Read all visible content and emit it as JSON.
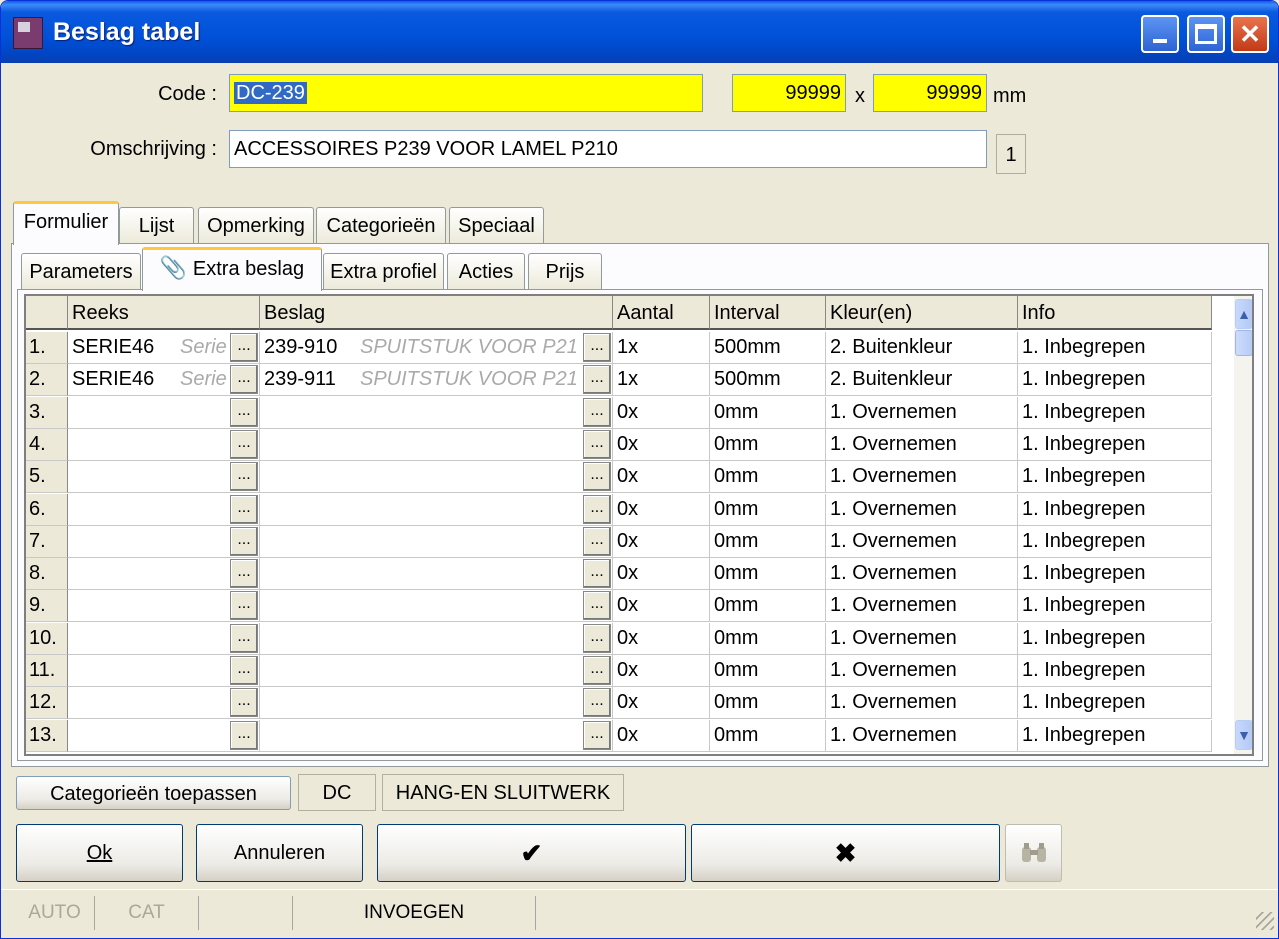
{
  "window": {
    "title": "Beslag tabel",
    "minimize_icon": "minimize-icon",
    "maximize_icon": "maximize-icon",
    "close_icon": "close-icon"
  },
  "form": {
    "code_label": "Code :",
    "code_value": "DC-239",
    "width_value": "99999",
    "times_sign": "x",
    "height_value": "99999",
    "unit": "mm",
    "omschrijving_label": "Omschrijving :",
    "omschrijving_value": "ACCESSOIRES P239 VOOR LAMEL P210",
    "counter": "1"
  },
  "main_tabs": [
    "Formulier",
    "Lijst",
    "Opmerking",
    "Categorieën",
    "Speciaal"
  ],
  "sub_tabs": [
    "Parameters",
    "Extra beslag",
    "Extra profiel",
    "Acties",
    "Prijs"
  ],
  "grid": {
    "columns": [
      "Reeks",
      "Beslag",
      "Aantal",
      "Interval",
      "Kleur(en)",
      "Info"
    ],
    "rows": [
      {
        "idx": "1.",
        "reeks": "SERIE46",
        "reeks_hint": "Serie",
        "beslag": "239-910",
        "beslag_hint": "SPUITSTUK VOOR P21",
        "aantal": "1x",
        "interval": "500mm",
        "kleur": "2. Buitenkleur",
        "info": "1. Inbegrepen"
      },
      {
        "idx": "2.",
        "reeks": "SERIE46",
        "reeks_hint": "Serie",
        "beslag": "239-911",
        "beslag_hint": "SPUITSTUK VOOR P21",
        "aantal": "1x",
        "interval": "500mm",
        "kleur": "2. Buitenkleur",
        "info": "1. Inbegrepen"
      },
      {
        "idx": "3.",
        "reeks": "",
        "reeks_hint": "",
        "beslag": "",
        "beslag_hint": "",
        "aantal": "0x",
        "interval": "0mm",
        "kleur": "1. Overnemen",
        "info": "1. Inbegrepen"
      },
      {
        "idx": "4.",
        "reeks": "",
        "reeks_hint": "",
        "beslag": "",
        "beslag_hint": "",
        "aantal": "0x",
        "interval": "0mm",
        "kleur": "1. Overnemen",
        "info": "1. Inbegrepen"
      },
      {
        "idx": "5.",
        "reeks": "",
        "reeks_hint": "",
        "beslag": "",
        "beslag_hint": "",
        "aantal": "0x",
        "interval": "0mm",
        "kleur": "1. Overnemen",
        "info": "1. Inbegrepen"
      },
      {
        "idx": "6.",
        "reeks": "",
        "reeks_hint": "",
        "beslag": "",
        "beslag_hint": "",
        "aantal": "0x",
        "interval": "0mm",
        "kleur": "1. Overnemen",
        "info": "1. Inbegrepen"
      },
      {
        "idx": "7.",
        "reeks": "",
        "reeks_hint": "",
        "beslag": "",
        "beslag_hint": "",
        "aantal": "0x",
        "interval": "0mm",
        "kleur": "1. Overnemen",
        "info": "1. Inbegrepen"
      },
      {
        "idx": "8.",
        "reeks": "",
        "reeks_hint": "",
        "beslag": "",
        "beslag_hint": "",
        "aantal": "0x",
        "interval": "0mm",
        "kleur": "1. Overnemen",
        "info": "1. Inbegrepen"
      },
      {
        "idx": "9.",
        "reeks": "",
        "reeks_hint": "",
        "beslag": "",
        "beslag_hint": "",
        "aantal": "0x",
        "interval": "0mm",
        "kleur": "1. Overnemen",
        "info": "1. Inbegrepen"
      },
      {
        "idx": "10.",
        "reeks": "",
        "reeks_hint": "",
        "beslag": "",
        "beslag_hint": "",
        "aantal": "0x",
        "interval": "0mm",
        "kleur": "1. Overnemen",
        "info": "1. Inbegrepen"
      },
      {
        "idx": "11.",
        "reeks": "",
        "reeks_hint": "",
        "beslag": "",
        "beslag_hint": "",
        "aantal": "0x",
        "interval": "0mm",
        "kleur": "1. Overnemen",
        "info": "1. Inbegrepen"
      },
      {
        "idx": "12.",
        "reeks": "",
        "reeks_hint": "",
        "beslag": "",
        "beslag_hint": "",
        "aantal": "0x",
        "interval": "0mm",
        "kleur": "1. Overnemen",
        "info": "1. Inbegrepen"
      },
      {
        "idx": "13.",
        "reeks": "",
        "reeks_hint": "",
        "beslag": "",
        "beslag_hint": "",
        "aantal": "0x",
        "interval": "0mm",
        "kleur": "1. Overnemen",
        "info": "1. Inbegrepen"
      }
    ],
    "ellipsis": "..."
  },
  "categories_bar": {
    "apply_label": "Categorieën toepassen",
    "code": "DC",
    "name": "HANG-EN SLUITWERK"
  },
  "buttons": {
    "ok": "Ok",
    "annuleren": "Annuleren",
    "check_glyph": "✔",
    "cross_glyph": "✖",
    "find_icon": "binoculars-icon"
  },
  "status": {
    "auto": "AUTO",
    "cat": "CAT",
    "mode": "INVOEGEN"
  },
  "colors": {
    "highlight": "#ffff00",
    "selection": "#316ac5",
    "titlebar": "#0054e3"
  }
}
